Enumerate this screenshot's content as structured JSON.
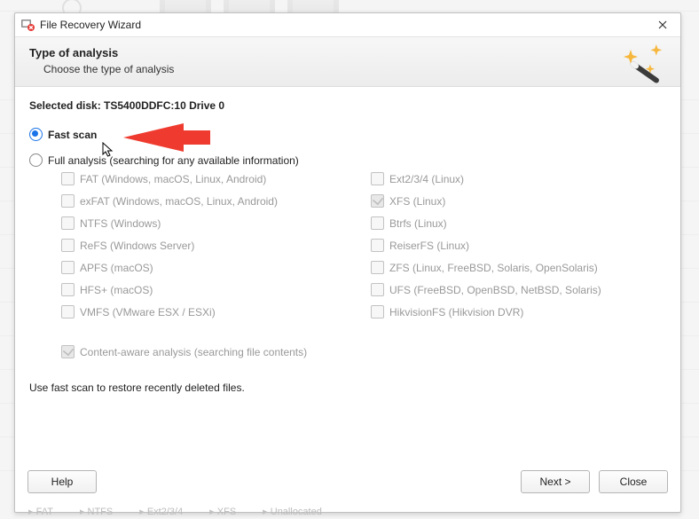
{
  "window": {
    "title": "File Recovery Wizard"
  },
  "header": {
    "title": "Type of analysis",
    "subtitle": "Choose the type of analysis"
  },
  "selected_disk_label": "Selected disk: TS5400DDFC:10 Drive 0",
  "radios": {
    "fast": "Fast scan",
    "full": "Full analysis (searching for any available information)"
  },
  "fs_options": {
    "left": [
      "FAT (Windows, macOS, Linux, Android)",
      "exFAT (Windows, macOS, Linux, Android)",
      "NTFS (Windows)",
      "ReFS (Windows Server)",
      "APFS (macOS)",
      "HFS+ (macOS)",
      "VMFS (VMware ESX / ESXi)"
    ],
    "right": [
      "Ext2/3/4 (Linux)",
      "XFS (Linux)",
      "Btrfs (Linux)",
      "ReiserFS (Linux)",
      "ZFS (Linux, FreeBSD, Solaris, OpenSolaris)",
      "UFS (FreeBSD, OpenBSD, NetBSD, Solaris)",
      "HikvisionFS (Hikvision DVR)"
    ]
  },
  "content_aware": "Content-aware analysis (searching file contents)",
  "hint": "Use fast scan to restore recently deleted files.",
  "buttons": {
    "help": "Help",
    "next": "Next >",
    "close": "Close"
  },
  "bg_status": [
    "FAT",
    "NTFS",
    "Ext2/3/4",
    "XFS",
    "Unallocated"
  ]
}
